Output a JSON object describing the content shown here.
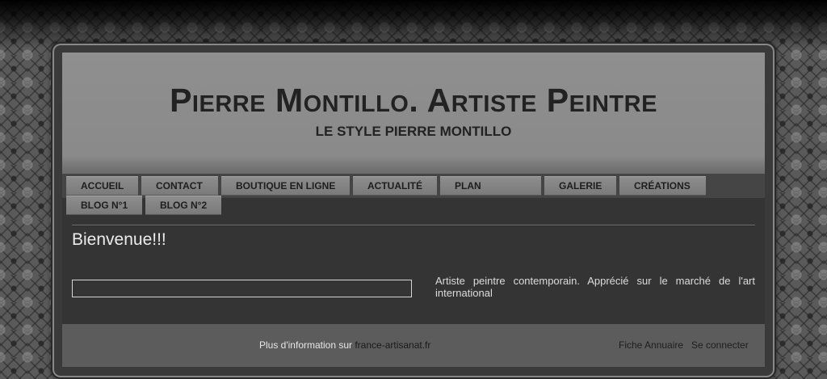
{
  "header": {
    "title": "Pierre Montillo. Artiste Peintre",
    "subtitle": "LE STYLE PIERRE MONTILLO"
  },
  "nav": {
    "items": [
      {
        "label": "ACCUEIL"
      },
      {
        "label": "CONTACT"
      },
      {
        "label": "BOUTIQUE EN LIGNE"
      },
      {
        "label": "ACTUALITÉ"
      },
      {
        "label": "PLAN"
      },
      {
        "label": "GALERIE"
      },
      {
        "label": "CRÉATIONS"
      },
      {
        "label": "BLOG N°1"
      },
      {
        "label": "BLOG N°2"
      }
    ]
  },
  "main": {
    "heading": "Bienvenue!!!",
    "description": "Artiste peintre contemporain. Apprécié sur le marché de l'art international"
  },
  "footer": {
    "info_prefix": "Plus d'information sur ",
    "info_link": "france-artisanat.fr",
    "annuaire_link": "Fiche Annuaire",
    "login_link": "Se connecter"
  }
}
